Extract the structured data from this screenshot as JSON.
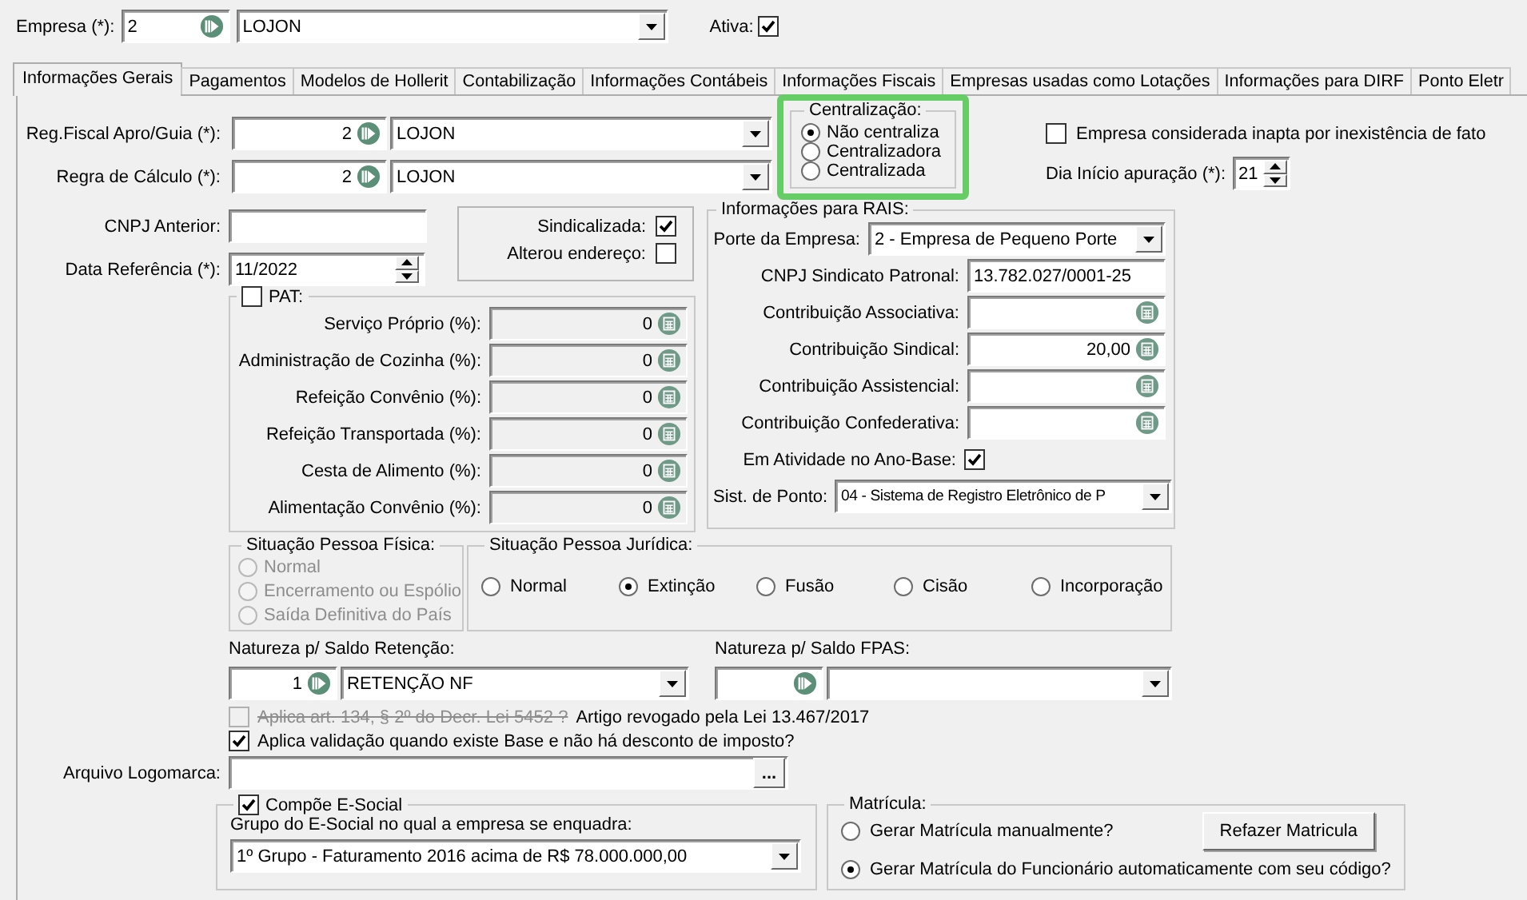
{
  "header": {
    "label": "Empresa (*):",
    "code": "2",
    "name": "LOJON",
    "active_label": "Ativa:",
    "active": true
  },
  "tabs": [
    {
      "label": "Informações Gerais",
      "selected": true
    },
    {
      "label": "Pagamentos",
      "selected": false
    },
    {
      "label": "Modelos de Hollerit",
      "selected": false
    },
    {
      "label": "Contabilização",
      "selected": false
    },
    {
      "label": "Informações Contábeis",
      "selected": false
    },
    {
      "label": "Informações Fiscais",
      "selected": false
    },
    {
      "label": "Empresas usadas como Lotações",
      "selected": false
    },
    {
      "label": "Informações para DIRF",
      "selected": false
    },
    {
      "label": "Ponto Eletr",
      "selected": false
    }
  ],
  "lookups": [
    {
      "label": "Reg.Fiscal Apro/Guia (*):",
      "code": "2",
      "name": "LOJON"
    },
    {
      "label": "Regra de Cálculo (*):",
      "code": "2",
      "name": "LOJON"
    }
  ],
  "centralizacao": {
    "title": "Centralização:",
    "highlighted": true,
    "options": [
      {
        "label": "Não centraliza",
        "selected": true
      },
      {
        "label": "Centralizadora",
        "selected": false
      },
      {
        "label": "Centralizada",
        "selected": false
      }
    ]
  },
  "inapta": {
    "label": "Empresa considerada inapta por inexistência de fato",
    "checked": false
  },
  "dia_inicio": {
    "label": "Dia Início apuração (*):",
    "value": "21"
  },
  "cnpj_anterior": {
    "label": "CNPJ Anterior:"
  },
  "data_referencia": {
    "label": "Data Referência (*):",
    "value": "11/2022"
  },
  "sindicato_flags": [
    {
      "label": "Sindicalizada:",
      "checked": true
    },
    {
      "label": "Alterou endereço:",
      "checked": false
    }
  ],
  "pat": {
    "title": "PAT:",
    "checked": false,
    "rows": [
      {
        "label": "Serviço Próprio (%):",
        "value": "0"
      },
      {
        "label": "Administração de Cozinha (%):",
        "value": "0"
      },
      {
        "label": "Refeição Convênio (%):",
        "value": "0"
      },
      {
        "label": "Refeição Transportada (%):",
        "value": "0"
      },
      {
        "label": "Cesta de Alimento (%):",
        "value": "0"
      },
      {
        "label": "Alimentação Convênio (%):",
        "value": "0"
      }
    ]
  },
  "rais": {
    "title": "Informações para RAIS:",
    "porte": {
      "label": "Porte da Empresa:",
      "value": "2 - Empresa de Pequeno Porte"
    },
    "cnpj_sindicato": {
      "label": "CNPJ Sindicato Patronal:",
      "value": "13.782.027/0001-25"
    },
    "contribuicoes": [
      {
        "label": "Contribuição Associativa:"
      },
      {
        "label": "Contribuição Sindical:",
        "value": "20,00"
      },
      {
        "label": "Contribuição Assistencial:"
      },
      {
        "label": "Contribuição Confederativa:"
      }
    ],
    "em_atividade": {
      "label": "Em Atividade no Ano-Base:",
      "checked": true
    },
    "sist_ponto": {
      "label": "Sist. de Ponto:",
      "value": "04 - Sistema de Registro Eletrônico de P"
    }
  },
  "situacao_pf": {
    "title": "Situação Pessoa Física:",
    "disabled": true,
    "options": [
      {
        "label": "Normal",
        "selected": false
      },
      {
        "label": "Encerramento ou Espólio",
        "selected": false
      },
      {
        "label": "Saída Definitiva do País",
        "selected": false
      }
    ]
  },
  "situacao_pj": {
    "title": "Situação Pessoa Jurídica:",
    "options": [
      {
        "label": "Normal",
        "selected": false
      },
      {
        "label": "Extinção",
        "selected": true
      },
      {
        "label": "Fusão",
        "selected": false
      },
      {
        "label": "Cisão",
        "selected": false
      },
      {
        "label": "Incorporação",
        "selected": false
      }
    ]
  },
  "natureza": [
    {
      "label": "Natureza p/ Saldo Retenção:",
      "code": "1",
      "name": "RETENÇÃO NF"
    },
    {
      "label": "Natureza p/ Saldo FPAS:"
    }
  ],
  "options": [
    {
      "label": "Aplica art. 134, § 2º do Decr. Lei 5452 ?",
      "note": "Artigo revogado pela Lei 13.467/2017",
      "checked": false,
      "disabled": true
    },
    {
      "label": "Aplica validação quando existe Base e não há desconto de imposto?",
      "checked": true,
      "disabled": false
    }
  ],
  "logomarca": {
    "label": "Arquivo Logomarca:",
    "button": "..."
  },
  "esocial": {
    "title": "Compõe E-Social",
    "checked": true,
    "group_label": "Grupo do E-Social no qual a empresa se enquadra:",
    "group_value": "1º Grupo - Faturamento 2016 acima de R$ 78.000.000,00"
  },
  "matricula": {
    "title": "Matrícula:",
    "button": "Refazer Matricula",
    "options": [
      {
        "label": "Gerar Matrícula manualmente?",
        "selected": false
      },
      {
        "label": "Gerar Matrícula do Funcionário automaticamente com seu código?",
        "selected": true
      }
    ]
  }
}
